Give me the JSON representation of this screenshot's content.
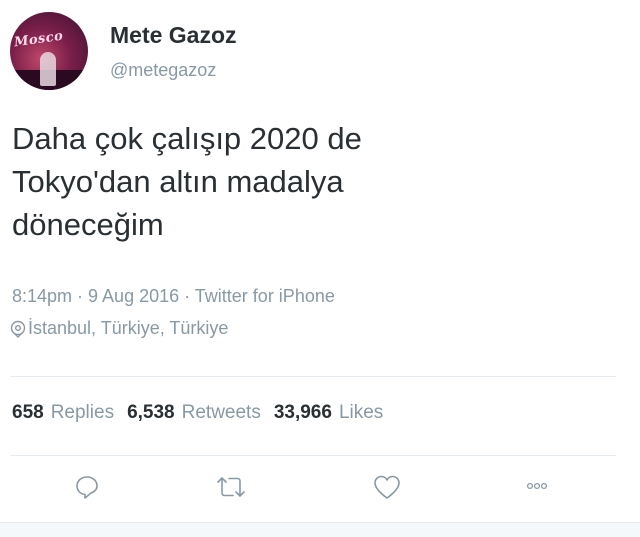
{
  "user": {
    "display_name": "Mete Gazoz",
    "handle": "@metegazoz",
    "avatar_text": "Mosco"
  },
  "tweet": {
    "lines": [
      "Daha çok çalışıp 2020 de",
      "Tokyo'dan altın madalya",
      "döneceğim"
    ],
    "meta": "8:14pm · 9 Aug 2016 · Twitter for iPhone",
    "location": "İstanbul, Türkiye, Türkiye"
  },
  "stats": {
    "replies_count": "658",
    "replies_label": "Replies",
    "retweets_count": "6,538",
    "retweets_label": "Retweets",
    "likes_count": "33,966",
    "likes_label": "Likes"
  },
  "actions": {
    "reply_icon": "reply-icon",
    "retweet_icon": "retweet-icon",
    "like_icon": "heart-icon",
    "more_icon": "more-icon"
  },
  "colors": {
    "text": "#292f33",
    "secondary": "#8899a6",
    "divider": "#e6ecf0"
  }
}
